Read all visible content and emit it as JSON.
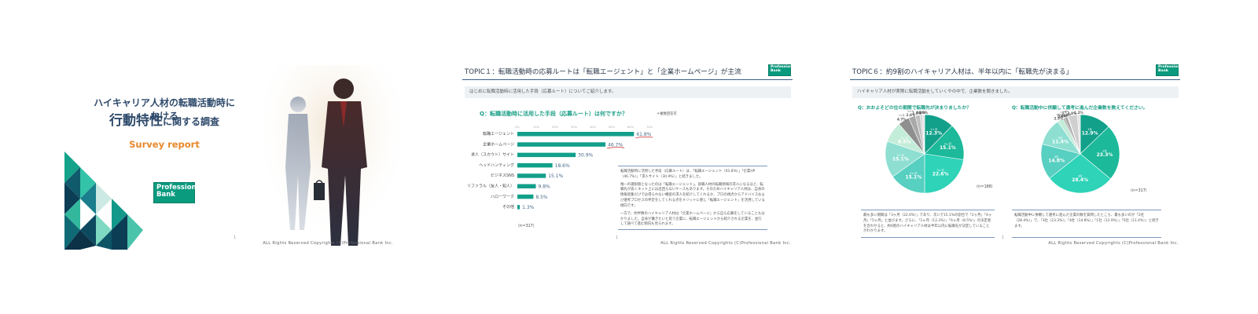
{
  "footer": "ALL Rights Reserved Copyrights (C)Professional Bank Inc.",
  "logo": {
    "line1": "Professional",
    "line2": "Bank"
  },
  "colors": {
    "brand_green": "#0a9a7e",
    "title_navy": "#2e4a6b",
    "accent_orange": "#e8882b",
    "bar_teal": "#12a08a",
    "rule_blue": "#3a5f8a"
  },
  "slide1": {
    "title_line1": "ハイキャリア人材の転職活動時における",
    "title_big": "行動特性",
    "title_rest": "に関する調査",
    "subtitle": "Survey report",
    "page": "1"
  },
  "slide2": {
    "topic": "TOPIC１：転職活動時の応募ルートは「転職エージェント」と「企業ホームページ」が主流",
    "intro": "はじめに転職活動時に活用した手段（応募ルート）についてご紹介します。",
    "question": "Q：転職活動時に活用した手段（応募ルート）は何ですか？",
    "note": "＊複数回答可",
    "n": "（n＝317）",
    "page": "1",
    "desc": [
      "転職活動時に活用した手段（応募ルート）は、「転職エージェント（61.8%）」「企業HP（46.7%）」「求人サイト（30.9%）」と続きました。",
      "唯一の選択肢となったのは「転職エージェント」。就職人材の転職領域の求人になるほど、転職先が高くネット上には出回らないケースもあります。そのためハイキャリア人材は、自身の情報収集だけでは得られない機密の求人を紹介してくれるか、プロの視点からアドバイスおよび選考プロセスの伴走をしてくれる点をメリットに感じ「転職エージェント」を活用している傾向です。",
      "一方で、約半数のハイキャリア人材は「企業ホームページ」から自ら応募をしていることも分かりました。自身が働きたいと思う企業に、転職エージェントから紹介される企業を、並行して調べて進む傾向も見られます。"
    ]
  },
  "slide3": {
    "topic": "TOPIC６：約9割のハイキャリア人材は、半年以内に「転職先が決まる」",
    "intro": "ハイキャリア人材が実際に転職活動をしていくやの中で、企業数を聞きました。",
    "q1": "Q：おおよそどの位の期間で転職先が決まりましたか？",
    "q2": "Q：転職活動中に併願して選考に進んだ企業数を教えてください。",
    "n1": "（n＝188）",
    "n2": "（n＝317）",
    "desc1": "最も多い期間は「3ヶ月（22.6%）」であり、次いで15.1%の割合で「2ヶ月」「4ヶ月」「5ヶ月」と並びます。さらに、「1ヶ月（12.3%）」「6ヶ月（8.5%）」の決定者を合わせると、約9割のハイキャリア人材は半年以内に転職先が決定していることがわかります。",
    "desc2": "転職活動中に併願して選考に進んだ企業の数を質問したところ、最も多いのが「2社（28.4%）」で、「3社（23.3%）」「4社（14.8%）」「1社（12.9%）」「5社（11.4%）」と続きます。",
    "page": "1"
  },
  "chart_data": [
    {
      "type": "bar",
      "orientation": "horizontal",
      "title": "Q：転職活動時に活用した手段（応募ルート）は何ですか？",
      "categories": [
        "転職エージェント",
        "企業ホームページ",
        "求人（スカウト）サイト",
        "ヘッドハンティング",
        "ビジネスSNS",
        "リファラル（友人・知人）",
        "ハローワーク",
        "その他"
      ],
      "values": [
        61.8,
        46.7,
        30.9,
        18.6,
        15.1,
        9.8,
        8.5,
        1.3
      ],
      "unit": "%",
      "xlim": [
        0,
        70
      ],
      "ticks": [
        "0%",
        "10%",
        "20%",
        "30%",
        "40%",
        "50%",
        "60%",
        "70%"
      ]
    },
    {
      "type": "pie",
      "title": "Q：おおよそどの位の期間で転職先が決まりましたか？",
      "slices": [
        {
          "label": "1ヶ月",
          "value": 12.3,
          "color": "#12a08a"
        },
        {
          "label": "2ヶ月",
          "value": 15.1,
          "color": "#1cb99a"
        },
        {
          "label": "3ヶ月",
          "value": 22.6,
          "color": "#2ed3b8"
        },
        {
          "label": "4ヶ月",
          "value": 15.1,
          "color": "#57cfc1"
        },
        {
          "label": "5ヶ月",
          "value": 15.1,
          "color": "#8edfd2"
        },
        {
          "label": "6ヶ月",
          "value": 8.5,
          "color": "#c3ecd9"
        },
        {
          "label": "7ヶ月",
          "value": 4.7,
          "color": "#8f8f8f"
        },
        {
          "label": "8ヶ月",
          "value": 2.8,
          "color": "#a9a9a9"
        },
        {
          "label": "9ヶ月",
          "value": 1.9,
          "color": "#bfbfbf"
        },
        {
          "label": "10ヶ月",
          "value": 0.9,
          "color": "#cfcfcf"
        },
        {
          "label": "11ヶ月",
          "value": 0.0,
          "color": "#dadada"
        },
        {
          "label": "12ヶ月以上",
          "value": 1.0,
          "color": "#e4e4e4"
        }
      ]
    },
    {
      "type": "pie",
      "title": "Q：転職活動中に併願して選考に進んだ企業数を教えてください。",
      "slices": [
        {
          "label": "1社",
          "value": 12.9,
          "color": "#12a08a"
        },
        {
          "label": "2社",
          "value": 23.3,
          "color": "#1cb99a"
        },
        {
          "label": "3社",
          "value": 28.4,
          "color": "#2ed3b8"
        },
        {
          "label": "4社",
          "value": 14.8,
          "color": "#57cfc1"
        },
        {
          "label": "5社",
          "value": 11.4,
          "color": "#8edfd2"
        },
        {
          "label": "6社",
          "value": 2.5,
          "color": "#c3ecd9"
        },
        {
          "label": "7社",
          "value": 0.6,
          "color": "#8f8f8f"
        },
        {
          "label": "8社",
          "value": 1.3,
          "color": "#a9a9a9"
        },
        {
          "label": "9社",
          "value": 0.3,
          "color": "#bfbfbf"
        },
        {
          "label": "10社以上",
          "value": 3.8,
          "color": "#cfcfcf"
        },
        {
          "label": "その他",
          "value": 1.2,
          "color": "#e4e4e4"
        }
      ]
    }
  ]
}
